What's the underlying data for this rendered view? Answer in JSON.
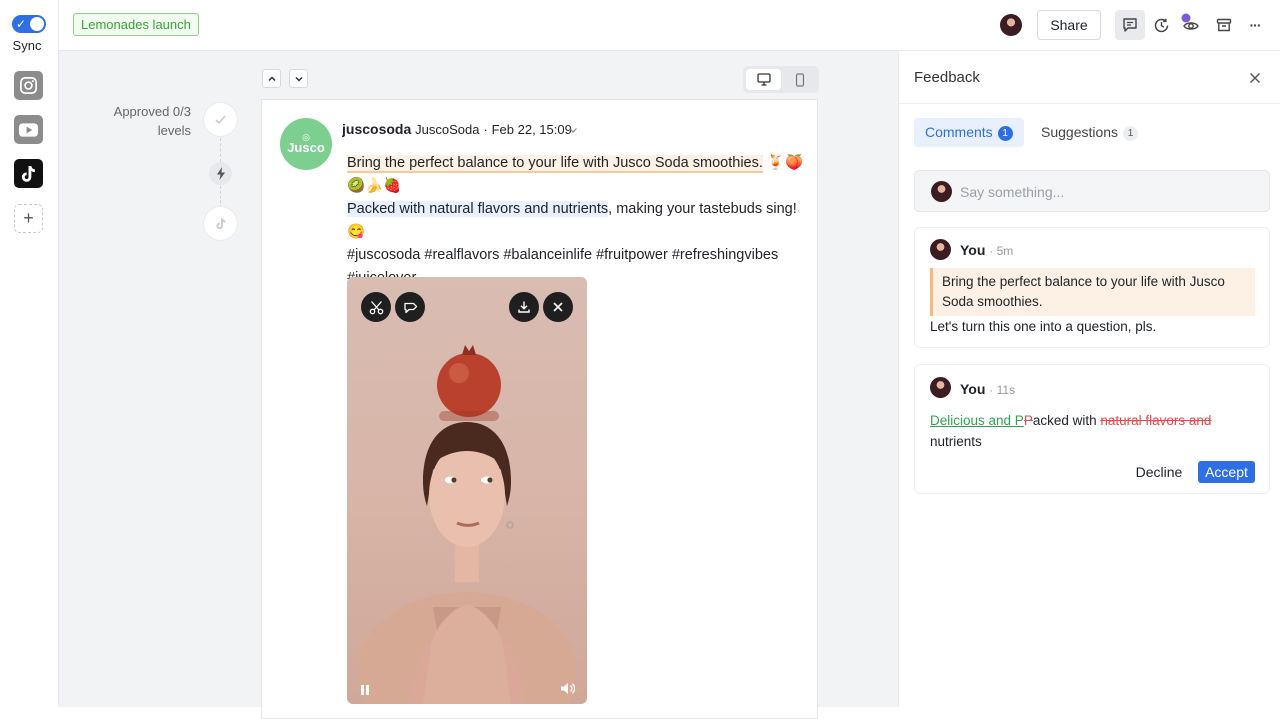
{
  "rail": {
    "sync_label": "Sync",
    "channels": [
      "instagram-icon",
      "youtube-icon",
      "tiktok-icon"
    ],
    "add_label": "+"
  },
  "topbar": {
    "campaign_tag": "Lemonades launch",
    "share_label": "Share",
    "icons": [
      "comments-icon",
      "history-icon",
      "preview-icon",
      "archive-icon",
      "more-icon"
    ],
    "more_label": "···"
  },
  "approval": {
    "label_line1": "Approved 0/3",
    "label_line2": "levels"
  },
  "post": {
    "account": "juscosoda",
    "display_name": "JuscoSoda",
    "date": "Feb 22, 15:09",
    "logo_text": "Jusco",
    "line1_highlight": "Bring the perfect balance to your life with Jusco Soda smoothies.",
    "line1_emoji": " 🍹🍑",
    "line2_emoji": "🥝🍌🍓",
    "line3_highlight": "Packed with natural flavors and nutrients",
    "line3_rest": ", making your tastebuds sing! 😋",
    "hashtags": "#juscosoda #realflavors #balanceinlife #fruitpower #refreshingvibes #juicelover"
  },
  "feedback": {
    "title": "Feedback",
    "tabs": [
      {
        "label": "Comments",
        "count": "1"
      },
      {
        "label": "Suggestions",
        "count": "1"
      }
    ],
    "input_placeholder": "Say something...",
    "comments": [
      {
        "author": "You",
        "time": "· 5m",
        "quote": "Bring the perfect balance to your life with Jusco Soda smoothies.",
        "body": "Let's turn this one into a question, pls."
      }
    ],
    "suggestion": {
      "author": "You",
      "time": "· 11s",
      "inserted": "Delicious and P",
      "deleted_char": "P",
      "kept1": "acked with ",
      "deleted": "natural flavors and ",
      "kept2": "nutrients",
      "decline_label": "Decline",
      "accept_label": "Accept"
    }
  },
  "colors": {
    "accent": "#2f6fe4",
    "tag_green": "#3aa23a",
    "insert_green": "#2ea44f",
    "delete_red": "#e5484d",
    "quote_bg": "#fdf0e4"
  }
}
